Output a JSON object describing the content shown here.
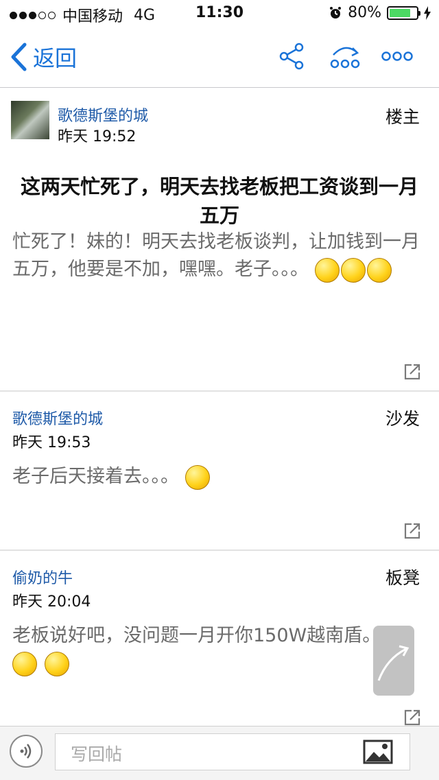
{
  "status_bar": {
    "carrier": "中国移动",
    "network": "4G",
    "time": "11:30",
    "battery": "80%",
    "battery_level": 0.8,
    "battery_color": "#4cd964"
  },
  "nav": {
    "back_label": "返回",
    "icons": [
      "chevron-left-icon",
      "share-icon",
      "reply-icon",
      "more-icon"
    ],
    "accent_color": "#1a73d8"
  },
  "posts": [
    {
      "author": "歌德斯堡的城",
      "time": "昨天 19:52",
      "floor": "楼主",
      "title": "这两天忙死了，明天去找老板把工资谈到一月五万",
      "content": "忙死了！妹的！明天去找老板谈判，让加钱到一月五万，他要是不加，嘿嘿。老子。。。"
    },
    {
      "author": "歌德斯堡的城",
      "time": "昨天 19:53",
      "floor": "沙发",
      "content": "老子后天接着去。。。"
    },
    {
      "author": "偷奶的牛",
      "time": "昨天 20:04",
      "floor": "板凳",
      "content": "老板说好吧，没问题一月开你150W越南盾。"
    }
  ],
  "bottom_bar": {
    "reply_placeholder": "写回帖",
    "icons": [
      "voice-icon",
      "image-icon"
    ]
  }
}
